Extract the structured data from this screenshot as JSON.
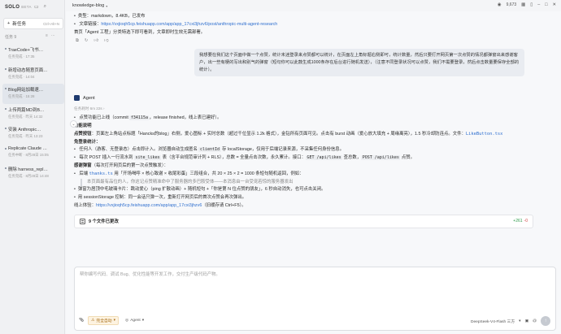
{
  "app": {
    "brand": "SOLO",
    "brand_sub": "BETA"
  },
  "sidebar": {
    "new_task_label": "新任务",
    "new_task_shortcut": "Ctrl+Alt+N",
    "section_label": "任务",
    "section_count": "9",
    "tasks": [
      {
        "title": "TraeCode+飞书…",
        "meta": "任务完成 · 17:35"
      },
      {
        "title": "新增动态随意页面…",
        "meta": "任务完成 · 14:04"
      },
      {
        "title": "Blog网站加载速…",
        "meta": "任务完成 · 15:28"
      },
      {
        "title": "上传两篇MD到B…",
        "meta": "任务完成 · 昨天 14:32"
      },
      {
        "title": "安装 Anthropic…",
        "meta": "任务完成 · 昨天 13:23"
      },
      {
        "title": "Replicate Claude …",
        "meta": "任务中断 · 8月28日 15:05"
      },
      {
        "title": "删除 harness_repl…",
        "meta": "任务完成 · 8月28日 14:48"
      }
    ]
  },
  "topbar": {
    "project": "knowledge-blog",
    "stars": "9,673"
  },
  "message_top": {
    "line_type": "类型：markdown，8.4KB，已发布",
    "line_link_prefix": "文章链接：",
    "line_link": "https://vxjioqh5cp.feishuapp.com/app/app_17cxi3jhzv6/post/anthropic-multi-agent-research",
    "line_done": "首页「Agent 工程」分类特选下即可看到，文章即时生效无需部署。"
  },
  "user_message": "我想要在我们这个页面中做一个点赞，统计未迷登录来点赞都可以统计，在页面左上角标题右侧即可，统计数量，然后只要打开网页第一次点赞的情况都弹窗出来感谢客户，出一些有梗的写出和别气的弹窗（短句你可以此鼓生成1000条存在后台进行随机发送），（注意不同登录状况可以点赞，我们不需要登录，然后点击数量要保存全部的统计）。",
  "agent": {
    "name": "Agent",
    "duration": "任务耗时 6m 22s",
    "commit_prefix": "点赞功能已上线（commit ",
    "commit_hash": "f34115a",
    "commit_suffix": "，release finished，线上表已建好）。",
    "h_feature": "功能说明",
    "feature_bold": "点赞按钮",
    "feature_text": "：页面左上角站点标题「Hancks的blog」右侧，爱心图标 + 实时总数（超过千位显示 1.2k 格式），金钻所有页面可见。点击有 burst 动画（爱心放大填充 + 周缘离亮），1.5 秒冷却防连点。文件：",
    "feature_file": "LikeButton.tsx",
    "h_dedup": "免登录统计：",
    "dedup_1_prefix": "任何人（游客、无登录态）点击即计入。浏览器自动生成匿名 ",
    "dedup_1_code": "clientId",
    "dedup_1_suffix": " 存 localStorage，仅用于后端记录来源，不采集任何身份信息。",
    "dedup_2_prefix": "每次 POST 插入一行流水到 ",
    "dedup_2_code": "site_likes",
    "dedup_2_mid": " 表（含平台规范审计列 + RLS），总数 = 全量点击次数，永久累计。接口：",
    "dedup_2_code2": "GET /api/likes",
    "dedup_2_mid2": " 查总数，",
    "dedup_2_code3": "POST /api/likes",
    "dedup_2_suffix": " 点赞。",
    "h_popup": "感谢弹窗",
    "popup_sub": "（每次打开网页后的第一次点赞触发）：",
    "popup_1_prefix": "后端 ",
    "popup_1_code": "thanks.ts",
    "popup_1_suffix": " 用「开场喝呼 × 核心致谢 × 收尾彩蛋」三段组合，共 20 × 25 × 2 = 1000 条短句随机返回，例如：",
    "popup_quote": "本页面最有品位的人，你这记点赞精准命中了服务器的多巴胺受体——本消息由一台受宠若惊的服务器发出",
    "popup_2": "弹窗为居顶中毛玻璃卡片：跳动爱心（ping 扩散动画）+ 随机短句 +「你是第 N 位点赞的朋友」，6 秒自动消失，也可点击关闭。",
    "popup_3": "用 sessionStorage 控制：同一会话只弹一次，重新打开网页后的首次点赞会再次弹出。",
    "exp_prefix": "线上体验：",
    "exp_link": "https://vxjioqh5cp.feishuapp.com/app/app_17cxi3jhzv6",
    "exp_suffix": "（旧缓存请 Ctrl+F5）。",
    "files_changed": "9 个文件已更改",
    "additions": "+261",
    "deletions": "-0"
  },
  "composer": {
    "placeholder": "帮你编写代码、调试 Bug、优化性能等开发工作，交付生产级代码产物。",
    "chip_warn": "完全自动",
    "chip_mode": "Agent",
    "model": "DeepSeek-V4-Flash 三方"
  },
  "colors": {
    "link": "#2f6fcf",
    "add": "#2e9b4b",
    "del": "#d04545",
    "accent_warn": "#a46a12"
  }
}
